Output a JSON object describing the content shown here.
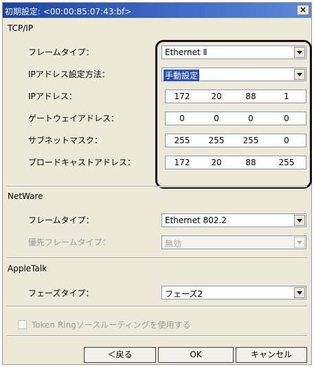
{
  "dialog": {
    "title": "初期設定: <00:00:85:07:43:bf>",
    "close_label": "×"
  },
  "tcpip": {
    "section": "TCP/IP",
    "frame_type_label": "フレームタイプ：",
    "frame_type_value": "Ethernet Ⅱ",
    "ip_method_label": "IPアドレス設定方法：",
    "ip_method_value": "手動設定",
    "ip_address_label": "IPアドレス：",
    "ip_address": [
      "172",
      "20",
      "88",
      "1"
    ],
    "gateway_label": "ゲートウェイアドレス：",
    "gateway": [
      "0",
      "0",
      "0",
      "0"
    ],
    "subnet_label": "サブネットマスク：",
    "subnet": [
      "255",
      "255",
      "255",
      "0"
    ],
    "broadcast_label": "ブロードキャストアドレス：",
    "broadcast": [
      "172",
      "20",
      "88",
      "255"
    ]
  },
  "netware": {
    "section": "NetWare",
    "frame_type_label": "フレームタイプ：",
    "frame_type_value": "Ethernet 802.2",
    "priority_label": "優先フレームタイプ：",
    "priority_value": "無効"
  },
  "appletalk": {
    "section": "AppleTalk",
    "phase_label": "フェーズタイプ：",
    "phase_value": "フェーズ2"
  },
  "tokenring": {
    "label": "Token Ringソースルーティングを使用する"
  },
  "buttons": {
    "back": "＜戻る",
    "ok": "OK",
    "cancel": "キャンセル"
  }
}
